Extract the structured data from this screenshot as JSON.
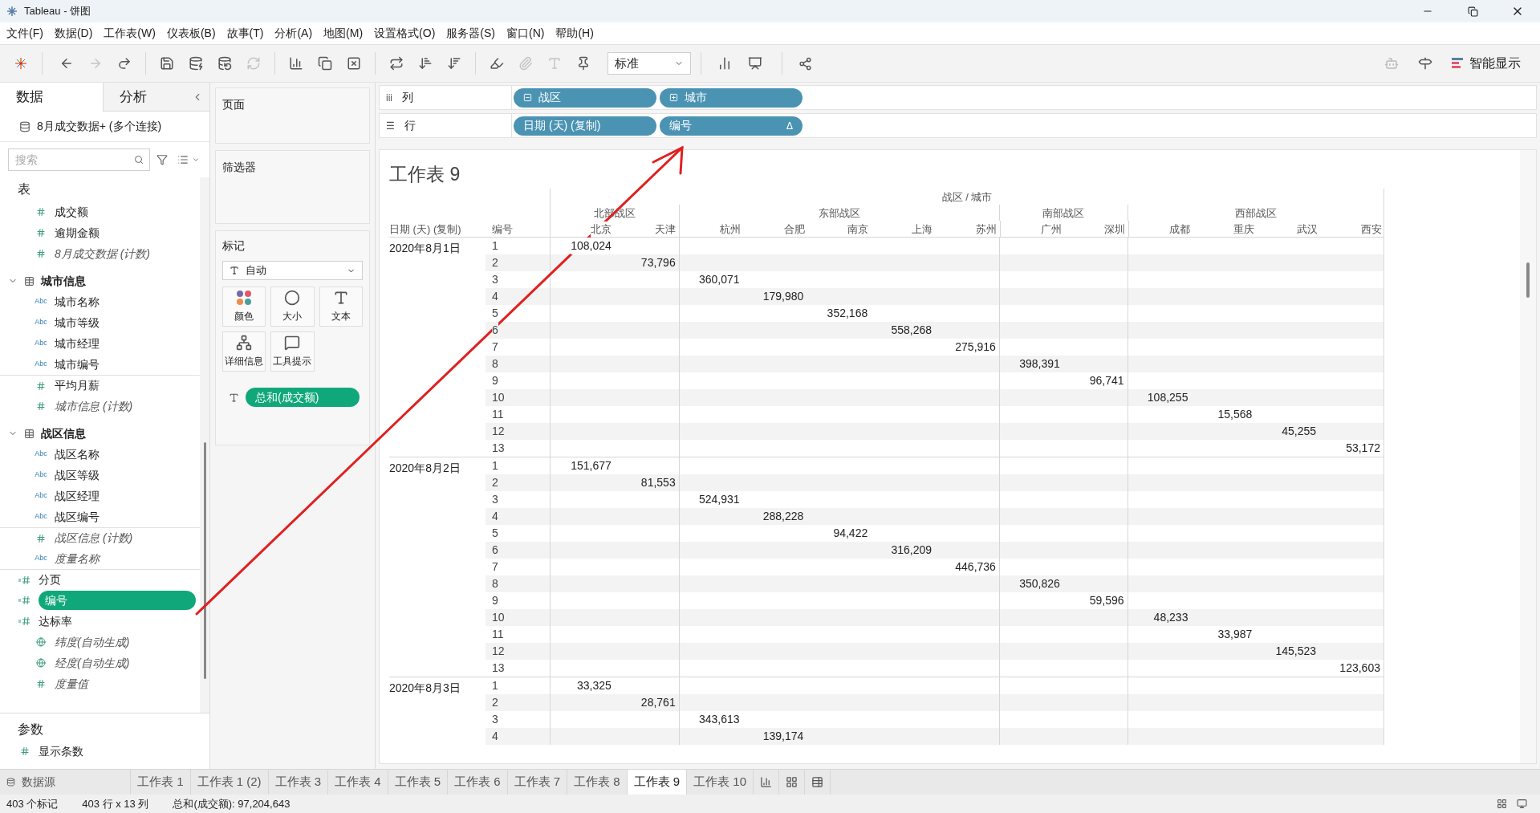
{
  "window": {
    "title": "Tableau - 饼图"
  },
  "menu": [
    "文件(F)",
    "数据(D)",
    "工作表(W)",
    "仪表板(B)",
    "故事(T)",
    "分析(A)",
    "地图(M)",
    "设置格式(O)",
    "服务器(S)",
    "窗口(N)",
    "帮助(H)"
  ],
  "toolbar": {
    "buttons": [
      {
        "kind": "back",
        "disabled": false
      },
      {
        "kind": "forward",
        "disabled": true
      },
      {
        "kind": "redo",
        "disabled": false
      },
      {
        "kind": "save",
        "disabled": false
      },
      {
        "kind": "new-source",
        "disabled": false
      },
      {
        "kind": "pause",
        "disabled": false
      },
      {
        "kind": "refresh",
        "disabled": true
      },
      {
        "kind": "new-sheet",
        "disabled": false
      },
      {
        "kind": "duplicate",
        "disabled": false
      },
      {
        "kind": "clear",
        "disabled": false
      },
      {
        "kind": "swap",
        "disabled": false
      },
      {
        "kind": "sort-asc",
        "disabled": false
      },
      {
        "kind": "sort-desc",
        "disabled": false
      },
      {
        "kind": "highlight",
        "disabled": false
      },
      {
        "kind": "attach",
        "disabled": true
      },
      {
        "kind": "labels",
        "disabled": true
      },
      {
        "kind": "pin",
        "disabled": false
      }
    ],
    "fit": "标准",
    "show_me": "智能显示"
  },
  "data_pane": {
    "tabs": [
      {
        "label": "数据",
        "selected": true
      },
      {
        "label": "分析",
        "selected": false
      }
    ],
    "datasource": "8月成交数据+ (多个连接)",
    "search": {
      "placeholder": "搜索"
    },
    "tables_heading": "表",
    "fields": [
      {
        "kind": "measure",
        "label": "成交额",
        "generated": false,
        "selected": false
      },
      {
        "kind": "measure",
        "label": "逾期金额",
        "generated": false,
        "selected": false
      },
      {
        "kind": "measure",
        "label": "8月成交数据 (计数)",
        "generated": true,
        "selected": false
      },
      {
        "kind": "folder",
        "label": "城市信息",
        "expanded": true,
        "children": [
          {
            "kind": "dimension",
            "icon_text": "Abc",
            "label": "城市名称",
            "generated": false,
            "selected": false
          },
          {
            "kind": "dimension",
            "icon_text": "Abc",
            "label": "城市等级",
            "generated": false,
            "selected": false
          },
          {
            "kind": "dimension",
            "icon_text": "Abc",
            "label": "城市经理",
            "generated": false,
            "selected": false
          },
          {
            "kind": "dimension",
            "icon_text": "Abc",
            "label": "城市编号",
            "generated": false,
            "selected": false
          },
          {
            "kind": "measure",
            "label": "平均月薪",
            "generated": false,
            "selected": false
          },
          {
            "kind": "measure",
            "label": "城市信息 (计数)",
            "generated": true,
            "selected": false
          }
        ]
      },
      {
        "kind": "folder",
        "label": "战区信息",
        "expanded": true,
        "children": [
          {
            "kind": "dimension",
            "icon_text": "Abc",
            "label": "战区名称",
            "generated": false,
            "selected": false
          },
          {
            "kind": "dimension",
            "icon_text": "Abc",
            "label": "战区等级",
            "generated": false,
            "selected": false
          },
          {
            "kind": "dimension",
            "icon_text": "Abc",
            "label": "战区经理",
            "generated": false,
            "selected": false
          },
          {
            "kind": "dimension",
            "icon_text": "Abc",
            "label": "战区编号",
            "generated": false,
            "selected": false
          },
          {
            "kind": "measure",
            "label": "战区信息 (计数)",
            "generated": true,
            "selected": false
          }
        ]
      },
      {
        "kind": "dimension",
        "icon_text": "Abc",
        "label": "度量名称",
        "generated": true,
        "selected": false
      },
      {
        "kind": "calc",
        "label": "分页",
        "generated": false,
        "selected": false
      },
      {
        "kind": "calc",
        "label": "编号",
        "generated": false,
        "selected": true
      },
      {
        "kind": "calc",
        "label": "达标率",
        "generated": false,
        "selected": false
      },
      {
        "kind": "geo",
        "label": "纬度(自动生成)",
        "generated": true,
        "selected": false
      },
      {
        "kind": "geo",
        "label": "经度(自动生成)",
        "generated": true,
        "selected": false
      },
      {
        "kind": "measure",
        "label": "度量值",
        "generated": true,
        "selected": false
      }
    ],
    "params_heading": "参数",
    "params": [
      {
        "kind": "measure",
        "label": "显示条数"
      }
    ]
  },
  "cards": {
    "pages": "页面",
    "filters": "筛选器",
    "marks": {
      "title": "标记",
      "type": "自动",
      "buttons": [
        {
          "kind": "color",
          "label": "颜色"
        },
        {
          "kind": "size",
          "label": "大小"
        },
        {
          "kind": "text",
          "label": "文本"
        },
        {
          "kind": "detail",
          "label": "详细信息"
        },
        {
          "kind": "tooltip",
          "label": "工具提示"
        }
      ],
      "pills": [
        {
          "kind": "text",
          "label": "总和(成交额)"
        }
      ]
    }
  },
  "shelves": [
    {
      "icon": "iii",
      "label": "列",
      "pills": [
        {
          "label": "战区",
          "expanded": true
        },
        {
          "label": "城市",
          "expanded": false
        }
      ]
    },
    {
      "icon": "☰",
      "label": "行",
      "pills": [
        {
          "label": "日期 (天) (复制)"
        },
        {
          "label": "编号",
          "suffix": "Δ"
        }
      ]
    }
  ],
  "sheet": {
    "title": "工作表 9",
    "column_title": "战区 / 城市",
    "row_headers": [
      "日期 (天) (复制)",
      "编号"
    ],
    "regions": [
      {
        "name": "北部战区",
        "cities": [
          "北京",
          "天津"
        ]
      },
      {
        "name": "东部战区",
        "cities": [
          "杭州",
          "合肥",
          "南京",
          "上海",
          "苏州"
        ]
      },
      {
        "name": "南部战区",
        "cities": [
          "广州",
          "深圳"
        ]
      },
      {
        "name": "西部战区",
        "cities": [
          "成都",
          "重庆",
          "武汉",
          "西安"
        ]
      }
    ],
    "groups": [
      {
        "date": "2020年8月1日",
        "rows": [
          {
            "id": "1",
            "value": "108,024"
          },
          {
            "id": "2",
            "value": "73,796"
          },
          {
            "id": "3",
            "value": "360,071"
          },
          {
            "id": "4",
            "value": "179,980"
          },
          {
            "id": "5",
            "value": "352,168"
          },
          {
            "id": "6",
            "value": "558,268"
          },
          {
            "id": "7",
            "value": "275,916"
          },
          {
            "id": "8",
            "value": "398,391"
          },
          {
            "id": "9",
            "value": "96,741"
          },
          {
            "id": "10",
            "value": "108,255"
          },
          {
            "id": "11",
            "value": "15,568"
          },
          {
            "id": "12",
            "value": "45,255"
          },
          {
            "id": "13",
            "value": "53,172"
          }
        ]
      },
      {
        "date": "2020年8月2日",
        "rows": [
          {
            "id": "1",
            "value": "151,677"
          },
          {
            "id": "2",
            "value": "81,553"
          },
          {
            "id": "3",
            "value": "524,931"
          },
          {
            "id": "4",
            "value": "288,228"
          },
          {
            "id": "5",
            "value": "94,422"
          },
          {
            "id": "6",
            "value": "316,209"
          },
          {
            "id": "7",
            "value": "446,736"
          },
          {
            "id": "8",
            "value": "350,826"
          },
          {
            "id": "9",
            "value": "59,596"
          },
          {
            "id": "10",
            "value": "48,233"
          },
          {
            "id": "11",
            "value": "33,987"
          },
          {
            "id": "12",
            "value": "145,523"
          },
          {
            "id": "13",
            "value": "123,603"
          }
        ]
      },
      {
        "date": "2020年8月3日",
        "rows": [
          {
            "id": "1",
            "value": "33,325"
          },
          {
            "id": "2",
            "value": "28,761"
          },
          {
            "id": "3",
            "value": "343,613"
          },
          {
            "id": "4",
            "value": "139,174"
          }
        ]
      }
    ]
  },
  "sheet_tabs": {
    "datasource": "数据源",
    "tabs": [
      {
        "label": "工作表 1",
        "selected": false
      },
      {
        "label": "工作表 1 (2)",
        "selected": false
      },
      {
        "label": "工作表 3",
        "selected": false
      },
      {
        "label": "工作表 4",
        "selected": false
      },
      {
        "label": "工作表 5",
        "selected": false
      },
      {
        "label": "工作表 6",
        "selected": false
      },
      {
        "label": "工作表 7",
        "selected": false
      },
      {
        "label": "工作表 8",
        "selected": false
      },
      {
        "label": "工作表 9",
        "selected": true
      },
      {
        "label": "工作表 10",
        "selected": false
      }
    ]
  },
  "status_bar": [
    "403 个标记",
    "403 行 x 13 列",
    "总和(成交额): 97,204,643"
  ]
}
